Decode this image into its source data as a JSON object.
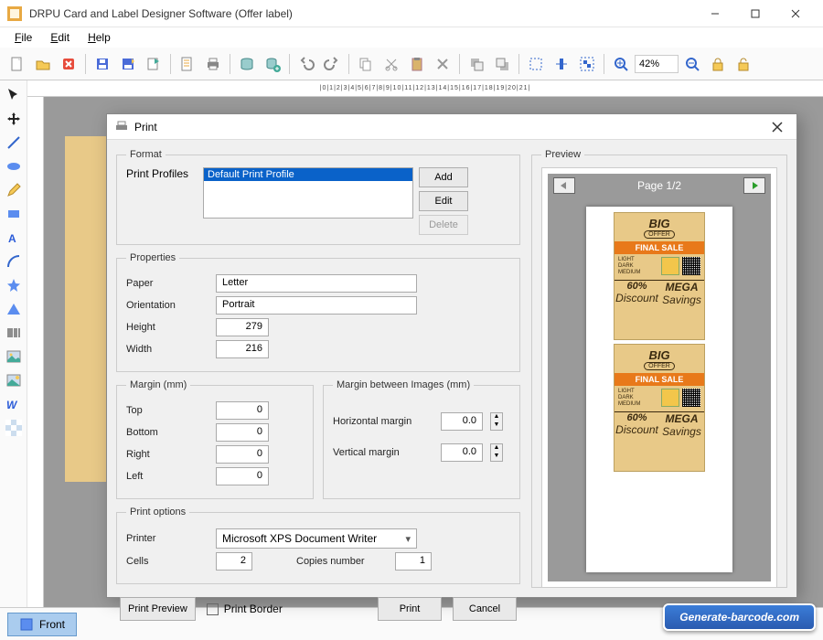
{
  "window": {
    "title": "DRPU Card and Label Designer Software (Offer label)"
  },
  "menu": {
    "file": "File",
    "edit": "Edit",
    "help": "Help"
  },
  "toolbar": {
    "zoom": "42%"
  },
  "dialog": {
    "title": "Print",
    "format": {
      "legend": "Format",
      "profiles_label": "Print Profiles",
      "profiles_selected": "Default Print Profile",
      "add": "Add",
      "edit": "Edit",
      "delete": "Delete"
    },
    "properties": {
      "legend": "Properties",
      "paper_label": "Paper",
      "paper": "Letter",
      "orientation_label": "Orientation",
      "orientation": "Portrait",
      "height_label": "Height",
      "height": "279",
      "width_label": "Width",
      "width": "216"
    },
    "margin": {
      "legend": "Margin (mm)",
      "top_label": "Top",
      "top": "0",
      "bottom_label": "Bottom",
      "bottom": "0",
      "right_label": "Right",
      "right": "0",
      "left_label": "Left",
      "left": "0"
    },
    "margin_images": {
      "legend": "Margin between Images (mm)",
      "h_label": "Horizontal margin",
      "h": "0.0",
      "v_label": "Vertical margin",
      "v": "0.0"
    },
    "print_options": {
      "legend": "Print options",
      "printer_label": "Printer",
      "printer": "Microsoft XPS Document Writer",
      "cells_label": "Cells",
      "cells": "2",
      "copies_label": "Copies number",
      "copies": "1"
    },
    "preview": {
      "legend": "Preview",
      "pager": "Page 1/2"
    },
    "footer": {
      "print_preview": "Print Preview",
      "print_border": "Print Border",
      "print": "Print",
      "cancel": "Cancel"
    }
  },
  "label_design": {
    "big": "BIG",
    "offer": "OFFER",
    "final": "FINAL SALE",
    "variants": "LIGHT\nDARK\nMEDIUM",
    "discount_pct": "60%",
    "discount_word": "Discount",
    "mega": "MEGA",
    "savings": "Savings"
  },
  "tabs": {
    "front": "Front"
  },
  "watermark": "Generate-barcode.com"
}
